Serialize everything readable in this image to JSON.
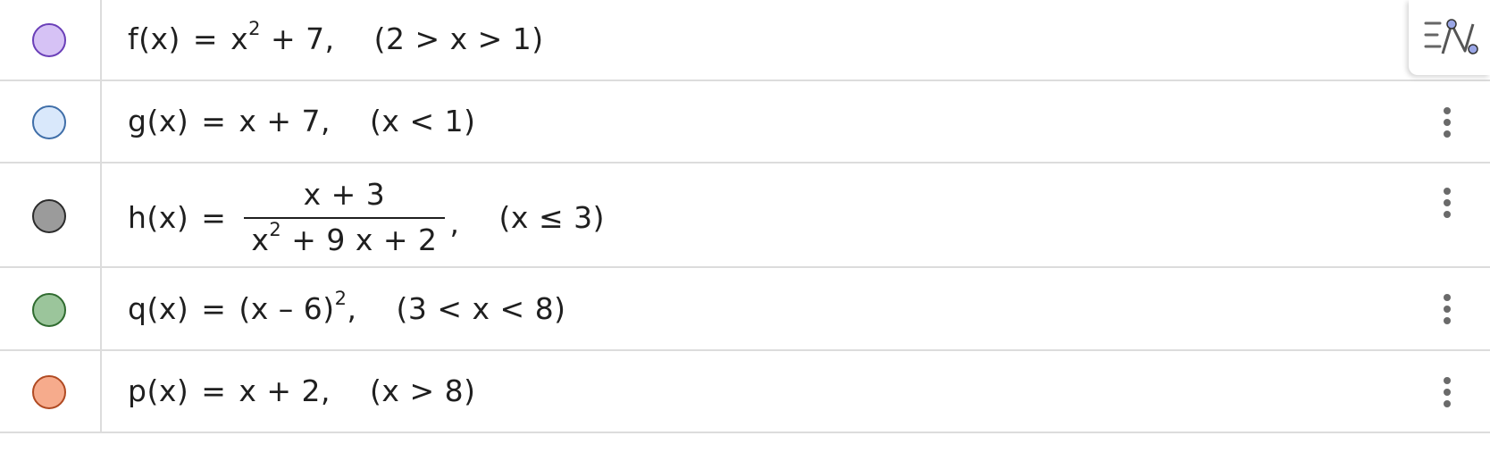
{
  "algebra_rows": [
    {
      "color": "#d6c2f5",
      "stroke": "#6a3fb8",
      "name": "f",
      "lhs": "f(x)",
      "rhs_a": "x",
      "exp": "2",
      "rhs_b": "+ 7,",
      "condition": "(2 > x > 1)"
    },
    {
      "color": "#d9e8fb",
      "stroke": "#3f6ea8",
      "name": "g",
      "lhs": "g(x)",
      "rhs": "x + 7,",
      "condition": "(x < 1)"
    },
    {
      "color": "#9b9b9b",
      "stroke": "#2b2b2b",
      "name": "h",
      "lhs": "h(x)",
      "numerator": "x + 3",
      "den_a": "x",
      "den_exp": "2",
      "den_b": "+ 9 x + 2",
      "comma": ",",
      "condition": "(x ≤ 3)"
    },
    {
      "color": "#9bc59b",
      "stroke": "#2f6b2f",
      "name": "q",
      "lhs": "q(x)",
      "rhs_a": "(x – 6)",
      "exp": "2",
      "rhs_b": ",",
      "condition": "(3 < x < 8)"
    },
    {
      "color": "#f6ab8c",
      "stroke": "#b04a22",
      "name": "p",
      "lhs": "p(x)",
      "rhs": "x + 2,",
      "condition": "(x > 8)"
    }
  ],
  "equals": "=",
  "icons": {
    "style_bar": "algebra-style-bar-icon",
    "more": "more-vertical-icon"
  }
}
